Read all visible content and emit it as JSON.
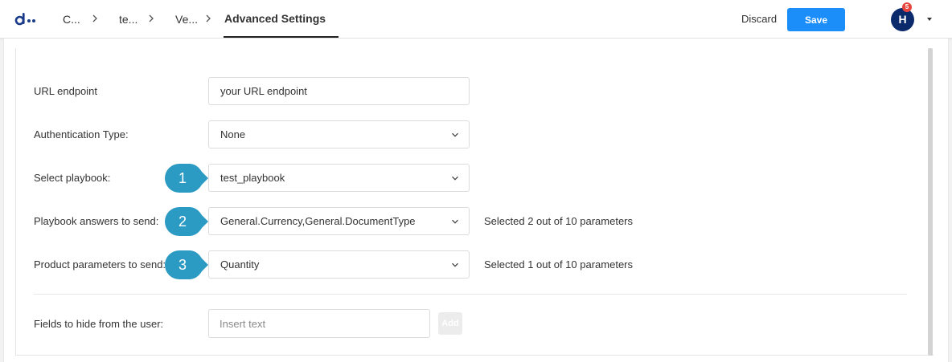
{
  "header": {
    "breadcrumbs": [
      "C...",
      "te...",
      "Ve..."
    ],
    "active_tab": "Advanced Settings",
    "discard_label": "Discard",
    "save_label": "Save",
    "avatar_initial": "H",
    "notification_count": "5",
    "brand_color": "#1c8ef9"
  },
  "form": {
    "url_endpoint": {
      "label": "URL endpoint",
      "value": "your URL endpoint"
    },
    "auth_type": {
      "label": "Authentication Type:",
      "value": "None"
    },
    "playbook": {
      "label": "Select playbook:",
      "value": "test_playbook"
    },
    "playbook_answers": {
      "label": "Playbook answers to send:",
      "value": "General.Currency,General.DocumentType",
      "note": "Selected 2 out of 10 parameters"
    },
    "product_params": {
      "label": "Product parameters to send:",
      "value": "Quantity",
      "note": "Selected 1 out of 10 parameters"
    },
    "hide_fields": {
      "label": "Fields to hide from the user:",
      "placeholder": "Insert text",
      "add_label": "Add"
    }
  },
  "callouts": [
    "1",
    "2",
    "3"
  ],
  "callout_color": "#2b9bc4"
}
